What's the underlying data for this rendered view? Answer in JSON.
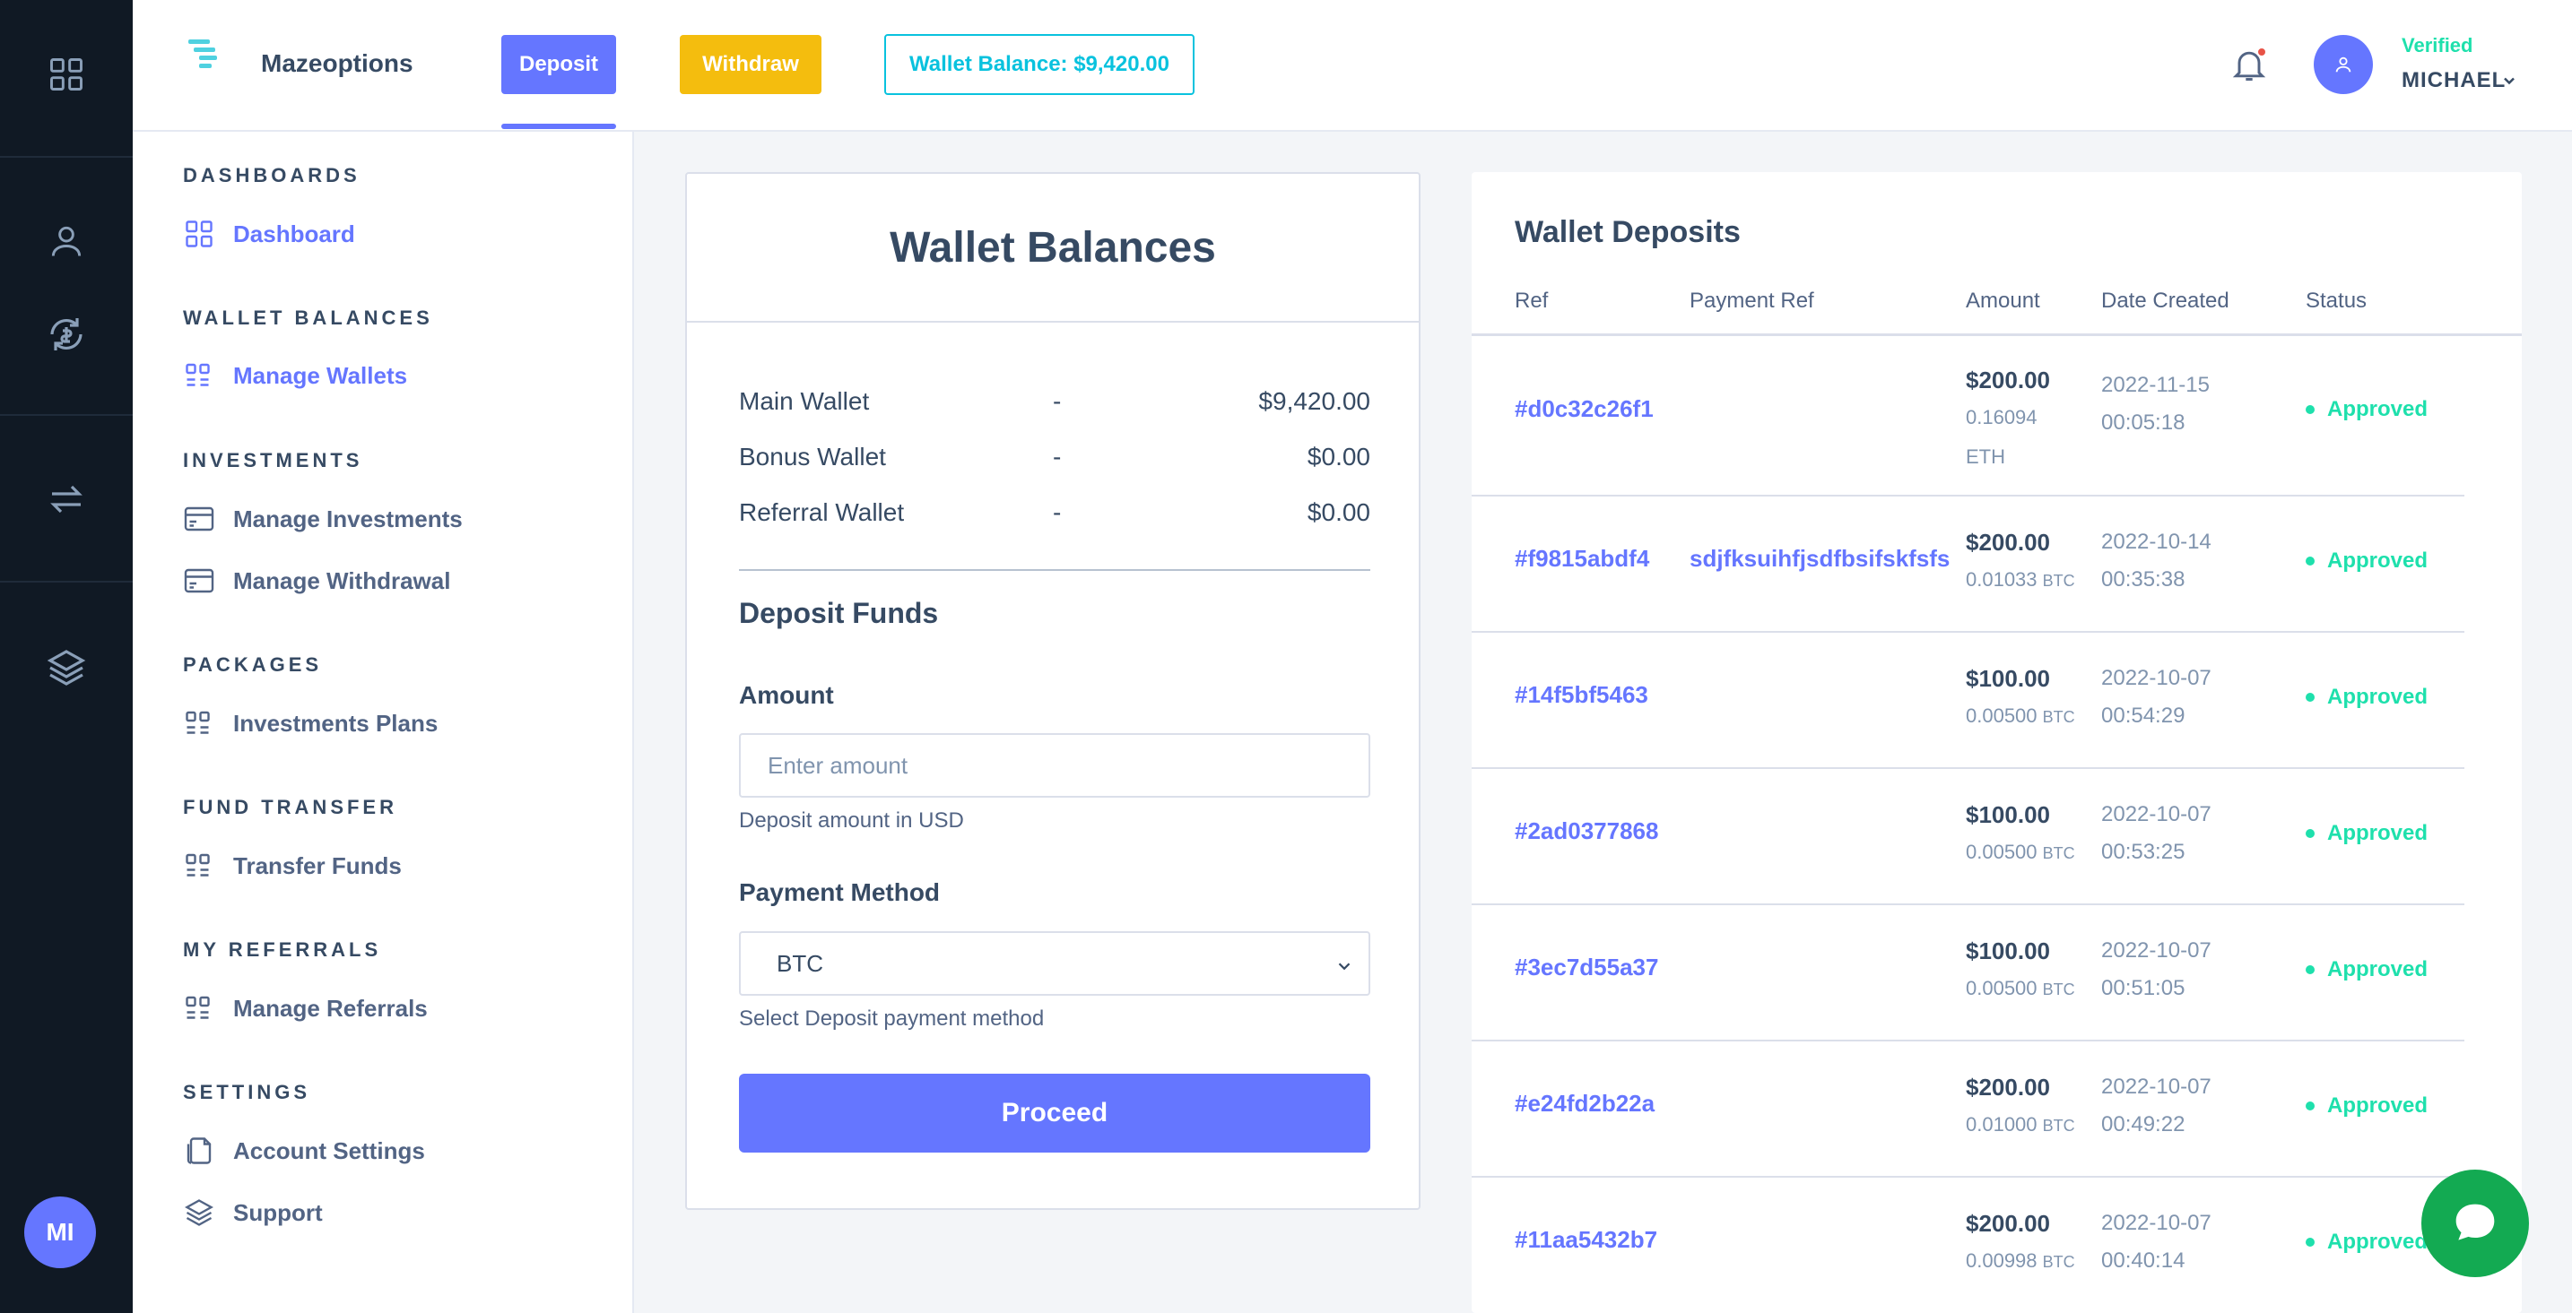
{
  "brand": {
    "name": "Mazeoptions"
  },
  "topbar": {
    "deposit_label": "Deposit",
    "withdraw_label": "Withdraw",
    "wallet_balance": "Wallet Balance: $9,420.00",
    "user_status": "Verified",
    "user_name": "MICHAEL"
  },
  "rail": {
    "avatar_initials": "MI",
    "icons": [
      "dashboard-icon",
      "user-icon",
      "exchange-icon",
      "transfer-icon",
      "layers-icon"
    ]
  },
  "sidebar": {
    "sections": [
      {
        "heading": "DASHBOARDS",
        "items": [
          {
            "label": "Dashboard",
            "icon": "dashboard-icon"
          }
        ]
      },
      {
        "heading": "WALLET BALANCES",
        "items": [
          {
            "label": "Manage Wallets",
            "icon": "grid-icon"
          }
        ]
      },
      {
        "heading": "INVESTMENTS",
        "items": [
          {
            "label": "Manage Investments",
            "icon": "card-icon"
          },
          {
            "label": "Manage Withdrawal",
            "icon": "card-icon"
          }
        ]
      },
      {
        "heading": "PACKAGES",
        "items": [
          {
            "label": "Investments Plans",
            "icon": "grid-icon"
          }
        ]
      },
      {
        "heading": "FUND TRANSFER",
        "items": [
          {
            "label": "Transfer Funds",
            "icon": "grid-icon"
          }
        ]
      },
      {
        "heading": "MY REFERRALS",
        "items": [
          {
            "label": "Manage Referrals",
            "icon": "grid-icon"
          }
        ]
      },
      {
        "heading": "SETTINGS",
        "items": [
          {
            "label": "Account Settings",
            "icon": "files-icon"
          },
          {
            "label": "Support",
            "icon": "layers-icon"
          }
        ]
      }
    ]
  },
  "wallet_balances": {
    "title": "Wallet Balances",
    "rows": [
      {
        "name": "Main Wallet",
        "sep": "-",
        "value": "$9,420.00"
      },
      {
        "name": "Bonus Wallet",
        "sep": "-",
        "value": "$0.00"
      },
      {
        "name": "Referral Wallet",
        "sep": "-",
        "value": "$0.00"
      }
    ]
  },
  "deposit_form": {
    "title": "Deposit Funds",
    "amount_label": "Amount",
    "amount_placeholder": "Enter amount",
    "amount_hint": "Deposit amount in USD",
    "method_label": "Payment Method",
    "method_value": "BTC",
    "method_hint": "Select Deposit payment method",
    "proceed_label": "Proceed"
  },
  "wallet_deposits": {
    "title": "Wallet Deposits",
    "columns": [
      "Ref",
      "Payment Ref",
      "Amount",
      "Date Created",
      "Status"
    ],
    "rows": [
      {
        "ref": "#d0c32c26f1",
        "payment_ref": "",
        "amount": "$200.00",
        "crypto": "0.16094",
        "currency": "ETH",
        "date": "2022-11-15",
        "time": "00:05:18",
        "status": "Approved"
      },
      {
        "ref": "#f9815abdf4",
        "payment_ref": "sdjfksuihfjsdfbsifskfsfs",
        "amount": "$200.00",
        "crypto": "0.01033",
        "currency": "BTC",
        "date": "2022-10-14",
        "time": "00:35:38",
        "status": "Approved"
      },
      {
        "ref": "#14f5bf5463",
        "payment_ref": "",
        "amount": "$100.00",
        "crypto": "0.00500",
        "currency": "BTC",
        "date": "2022-10-07",
        "time": "00:54:29",
        "status": "Approved"
      },
      {
        "ref": "#2ad0377868",
        "payment_ref": "",
        "amount": "$100.00",
        "crypto": "0.00500",
        "currency": "BTC",
        "date": "2022-10-07",
        "time": "00:53:25",
        "status": "Approved"
      },
      {
        "ref": "#3ec7d55a37",
        "payment_ref": "",
        "amount": "$100.00",
        "crypto": "0.00500",
        "currency": "BTC",
        "date": "2022-10-07",
        "time": "00:51:05",
        "status": "Approved"
      },
      {
        "ref": "#e24fd2b22a",
        "payment_ref": "",
        "amount": "$200.00",
        "crypto": "0.01000",
        "currency": "BTC",
        "date": "2022-10-07",
        "time": "00:49:22",
        "status": "Approved"
      },
      {
        "ref": "#11aa5432b7",
        "payment_ref": "",
        "amount": "$200.00",
        "crypto": "0.00998",
        "currency": "BTC",
        "date": "2022-10-07",
        "time": "00:40:14",
        "status": "Approved"
      }
    ]
  },
  "colors": {
    "accent": "#6576ff",
    "warning": "#f4bd0e",
    "info": "#09c2de",
    "success": "#1ee0ac",
    "rail": "#101924",
    "chat": "#13aa52"
  }
}
